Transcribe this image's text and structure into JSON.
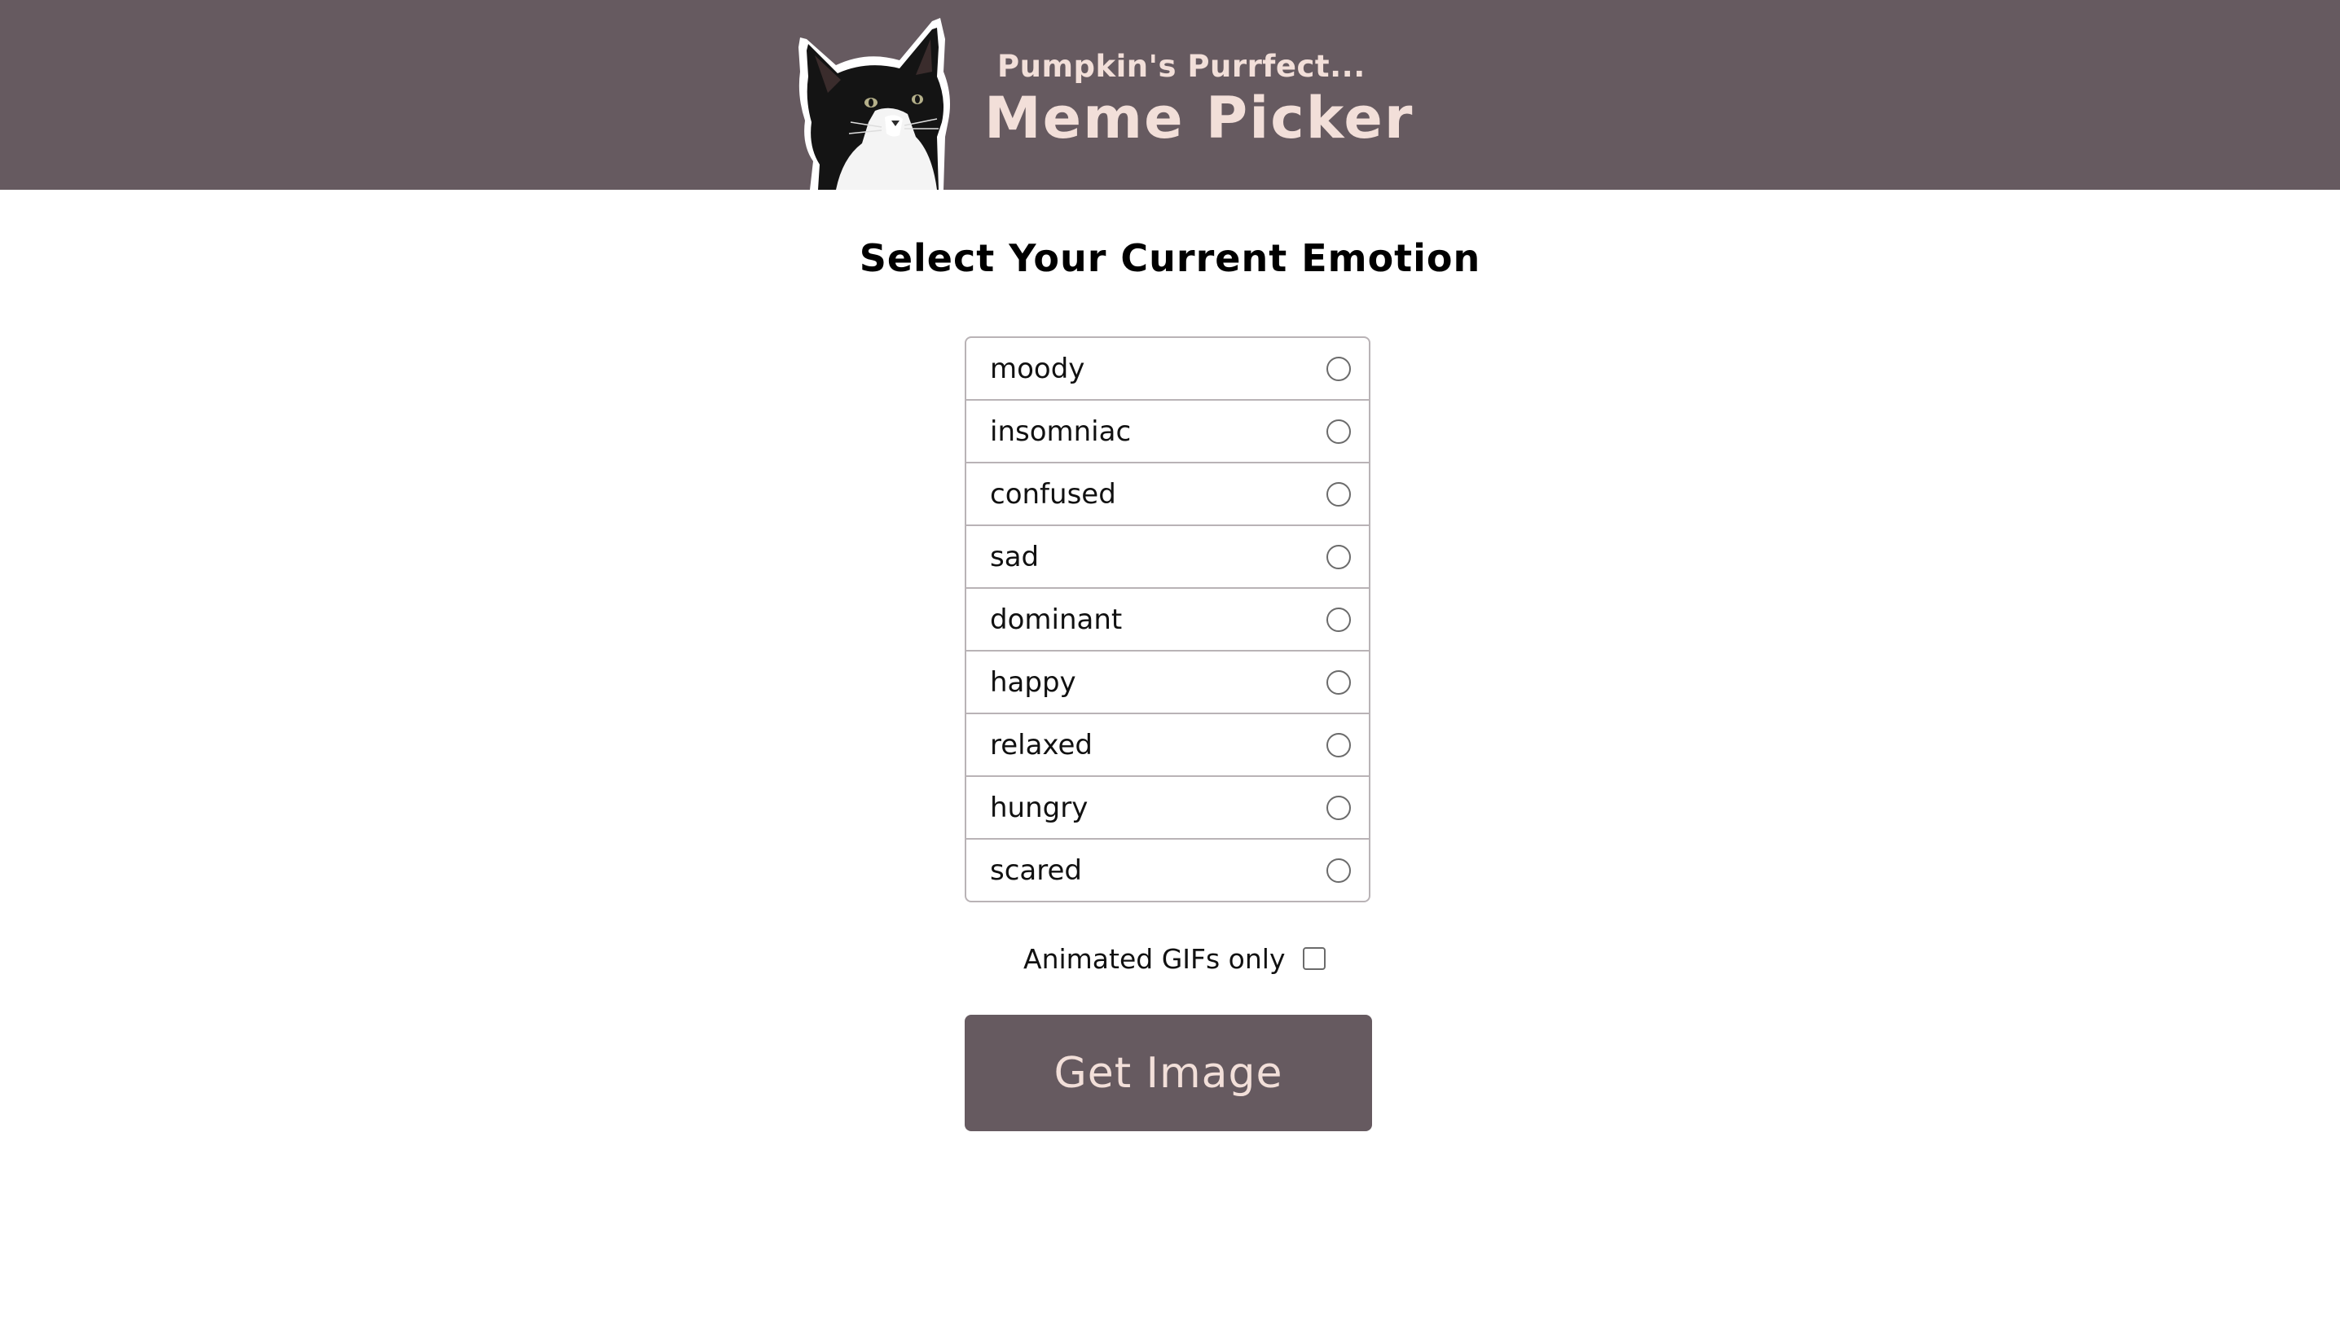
{
  "header": {
    "subtitle": "Pumpkin's Purrfect...",
    "title": "Meme Picker",
    "logo_icon": "tuxedo-cat-logo",
    "background_color": "#665a60",
    "text_color": "#f2dfd9"
  },
  "main": {
    "heading": "Select Your Current Emotion",
    "emotions": [
      {
        "label": "moody",
        "selected": false
      },
      {
        "label": "insomniac",
        "selected": false
      },
      {
        "label": "confused",
        "selected": false
      },
      {
        "label": "sad",
        "selected": false
      },
      {
        "label": "dominant",
        "selected": false
      },
      {
        "label": "happy",
        "selected": false
      },
      {
        "label": "relaxed",
        "selected": false
      },
      {
        "label": "hungry",
        "selected": false
      },
      {
        "label": "scared",
        "selected": false
      }
    ],
    "gif_option": {
      "label": "Animated GIFs only",
      "checked": false
    },
    "get_button_label": "Get Image"
  }
}
